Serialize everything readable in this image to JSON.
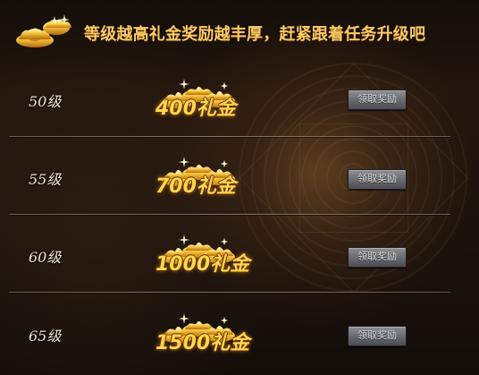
{
  "header": {
    "title": "等级越高礼金奖励越丰厚，赶紧跟着任务升级吧"
  },
  "rows": [
    {
      "level": "50级",
      "reward": "400礼金",
      "button": "领取奖励"
    },
    {
      "level": "55级",
      "reward": "700礼金",
      "button": "领取奖励"
    },
    {
      "level": "60级",
      "reward": "1000礼金",
      "button": "领取奖励"
    },
    {
      "level": "65级",
      "reward": "1500礼金",
      "button": "领取奖励"
    }
  ],
  "colors": {
    "title": "#ffcb62",
    "reward": "#ffd64f",
    "button": "#6b6d72",
    "background": "#1b120c"
  },
  "icons": {
    "header": "gold-ingot-icon",
    "reward": "gold-ingots-icon"
  }
}
